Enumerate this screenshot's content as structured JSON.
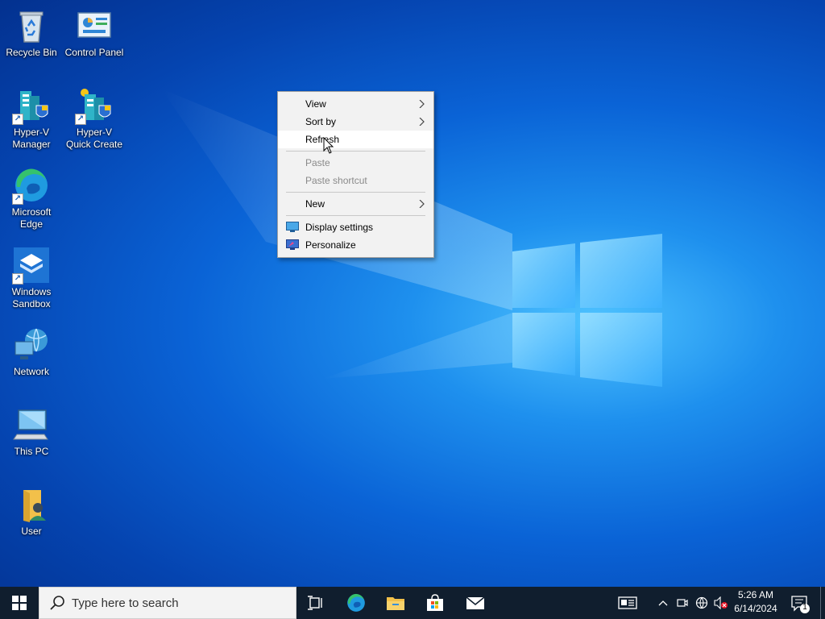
{
  "desktop": {
    "icons": [
      {
        "label": "Recycle Bin",
        "icon": "recycle-bin-icon"
      },
      {
        "label": "Control Panel",
        "icon": "control-panel-icon"
      },
      {
        "label": "Hyper-V Manager",
        "icon": "hyper-v-manager-icon"
      },
      {
        "label": "Hyper-V Quick Create",
        "icon": "hyper-v-quick-create-icon"
      },
      {
        "label": "Microsoft Edge",
        "icon": "edge-icon"
      },
      {
        "label": "Windows Sandbox",
        "icon": "sandbox-icon"
      },
      {
        "label": "Network",
        "icon": "network-icon"
      },
      {
        "label": "This PC",
        "icon": "this-pc-icon"
      },
      {
        "label": "User",
        "icon": "user-folder-icon"
      }
    ]
  },
  "context_menu": {
    "view": "View",
    "sort_by": "Sort by",
    "refresh": "Refresh",
    "paste": "Paste",
    "paste_shortcut": "Paste shortcut",
    "new": "New",
    "display_settings": "Display settings",
    "personalize": "Personalize"
  },
  "taskbar": {
    "search_placeholder": "Type here to search",
    "time": "5:26 AM",
    "date": "6/14/2024",
    "notification_count": "1"
  },
  "colors": {
    "taskbar_bg": "#101e2e",
    "menu_bg": "#f2f2f2",
    "menu_highlight": "#ffffff",
    "disabled_text": "#8a8a8a"
  }
}
